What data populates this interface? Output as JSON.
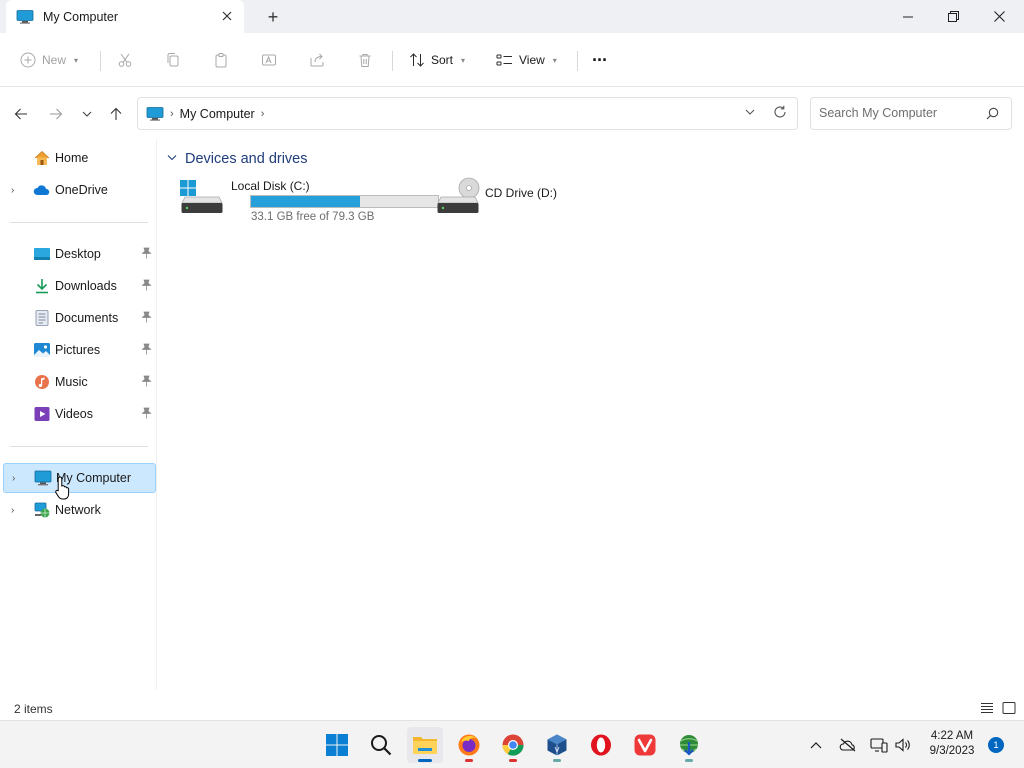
{
  "window": {
    "tab_title": "My Computer",
    "new_tab_symbol": "+"
  },
  "commands": {
    "new_label": "New",
    "sort_label": "Sort",
    "view_label": "View",
    "more_label": "···"
  },
  "address": {
    "crumb": "My Computer"
  },
  "search": {
    "placeholder": "Search My Computer"
  },
  "sidebar": {
    "items": [
      {
        "label": "Home",
        "icon": "home-icon"
      },
      {
        "label": "OneDrive",
        "icon": "onedrive-icon"
      },
      {
        "label": "Desktop",
        "icon": "desktop-folder-icon"
      },
      {
        "label": "Downloads",
        "icon": "downloads-icon"
      },
      {
        "label": "Documents",
        "icon": "documents-icon"
      },
      {
        "label": "Pictures",
        "icon": "pictures-icon"
      },
      {
        "label": "Music",
        "icon": "music-icon"
      },
      {
        "label": "Videos",
        "icon": "videos-icon"
      },
      {
        "label": "My Computer",
        "icon": "computer-icon",
        "selected": true
      },
      {
        "label": "Network",
        "icon": "network-icon"
      }
    ]
  },
  "content": {
    "group_title": "Devices and drives",
    "drives": [
      {
        "name": "Local Disk (C:)",
        "free_text": "33.1 GB free of 79.3 GB",
        "used_fraction": 0.583
      },
      {
        "name": "CD Drive (D:)"
      }
    ]
  },
  "status": {
    "item_count": "2 items"
  },
  "taskbar": {
    "clock_time": "4:22 AM",
    "clock_date": "9/3/2023",
    "notification_count": "1"
  },
  "colors": {
    "accent": "#0067c0",
    "selection": "#cce8ff",
    "drive_bar": "#26a0da",
    "group_title": "#1f3d7a"
  }
}
